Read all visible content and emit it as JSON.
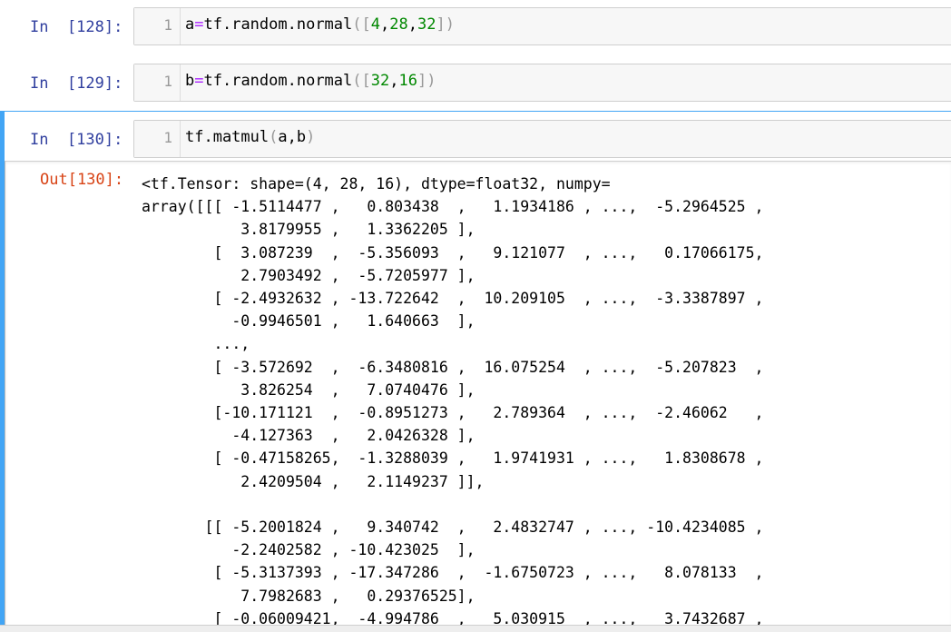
{
  "cells": [
    {
      "prompt": "In  [128]:",
      "line_number": "1",
      "code_parts": [
        "a",
        "=",
        "tf.random.normal",
        "(",
        "[",
        "4",
        ",",
        "28",
        ",",
        "32",
        "]",
        ")"
      ]
    },
    {
      "prompt": "In  [129]:",
      "line_number": "1",
      "code_parts": [
        "b",
        "=",
        "tf.random.normal",
        "(",
        "[",
        "32",
        ",",
        "16",
        "]",
        ")"
      ]
    },
    {
      "prompt": "In  [130]:",
      "line_number": "1",
      "code_parts": [
        "tf.matmul",
        "(",
        "a,b",
        ")"
      ]
    }
  ],
  "output": {
    "prompt": "Out[130]:",
    "text": "<tf.Tensor: shape=(4, 28, 16), dtype=float32, numpy=\narray([[[ -1.5114477 ,   0.803438  ,   1.1934186 , ...,  -5.2964525 ,\n           3.8179955 ,   1.3362205 ],\n        [  3.087239  ,  -5.356093  ,   9.121077  , ...,   0.17066175,\n           2.7903492 ,  -5.7205977 ],\n        [ -2.4932632 , -13.722642  ,  10.209105  , ...,  -3.3387897 ,\n          -0.9946501 ,   1.640663  ],\n        ...,\n        [ -3.572692  ,  -6.3480816 ,  16.075254  , ...,  -5.207823  ,\n           3.826254  ,   7.0740476 ],\n        [-10.171121  ,  -0.8951273 ,   2.789364  , ...,  -2.46062   ,\n          -4.127363  ,   2.0426328 ],\n        [ -0.47158265,  -1.3288039 ,   1.9741931 , ...,   1.8308678 ,\n           2.4209504 ,   2.1149237 ]],\n\n       [[ -5.2001824 ,   9.340742  ,   2.4832747 , ..., -10.4234085 ,\n          -2.2402582 , -10.423025  ],\n        [ -5.3137393 , -17.347286  ,  -1.6750723 , ...,   8.078133  ,\n           7.7982683 ,   0.29376525],\n        [ -0.06009421,  -4.994786  ,   5.030915  , ...,   3.7432687 ,"
  }
}
